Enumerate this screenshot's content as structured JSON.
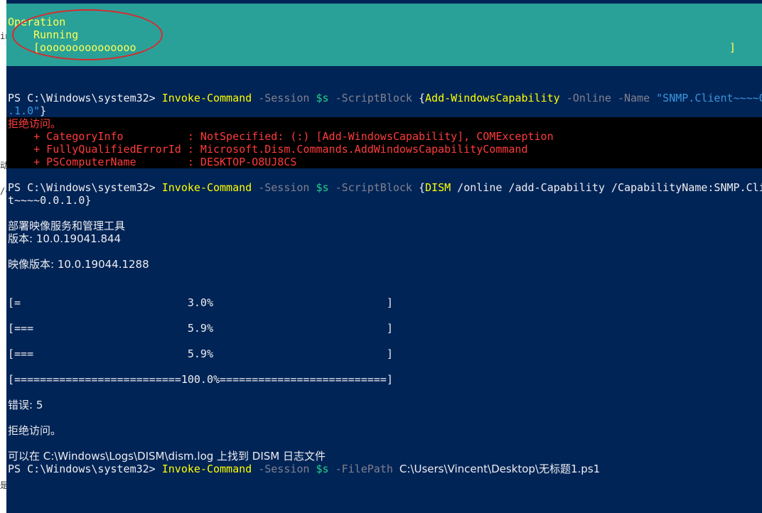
{
  "left_strip": {
    "glyphs": [
      "in",
      "/c",
      "动",
      "是"
    ]
  },
  "banner": {
    "operation": "Operation",
    "status": "Running",
    "progress_open": "[ooooooooooooooo",
    "progress_close": "]"
  },
  "cmd1": {
    "prompt": "PS C:\\Windows\\system32> ",
    "cmdlet": "Invoke-Command",
    "p_session": " -Session ",
    "var": "$s",
    "p_scriptblock": " -ScriptBlock ",
    "brace_open": "{",
    "inner_cmd": "Add-WindowsCapability",
    "p_online": " -Online",
    "p_name": " -Name ",
    "name_val": "\"SNMP.Client~~~~0",
    "wrap_val": ".1.0\"",
    "brace_close": "}"
  },
  "error1": {
    "title": "拒绝访问。",
    "line1": "    + CategoryInfo          : NotSpecified: (:) [Add-WindowsCapability], COMException",
    "line2": "    + FullyQualifiedErrorId : Microsoft.Dism.Commands.AddWindowsCapabilityCommand",
    "line3": "    + PSComputerName        : DESKTOP-O8UJ8CS"
  },
  "cmd2": {
    "prompt": "PS C:\\Windows\\system32> ",
    "cmdlet": "Invoke-Command",
    "p_session": " -Session ",
    "var": "$s",
    "p_scriptblock": " -ScriptBlock ",
    "brace_open": "{",
    "inner_cmd": "DISM",
    "args": " /online /add-Capability /CapabilityName:SNMP.Cli",
    "wrap": "t~~~~0.0.1.0",
    "brace_close": "}"
  },
  "dism": {
    "tool_name": "部署映像服务和管理工具",
    "version": "版本: 10.0.19041.844",
    "image_version": "映像版本: 10.0.19044.1288",
    "progress": [
      "[=                          3.0%                           ]",
      "[===                        5.9%                           ]",
      "[===                        5.9%                           ]",
      "[==========================100.0%==========================]"
    ],
    "error_code": "错误: 5",
    "error_msg": "拒绝访问。",
    "log_hint": "可以在 C:\\Windows\\Logs\\DISM\\dism.log 上找到 DISM 日志文件"
  },
  "cmd3": {
    "prompt": "PS C:\\Windows\\system32> ",
    "cmdlet": "Invoke-Command",
    "p_session": " -Session ",
    "var": "$s",
    "p_filepath": " -FilePath ",
    "path": "C:\\Users\\Vincent\\Desktop\\无标题1.ps1"
  }
}
